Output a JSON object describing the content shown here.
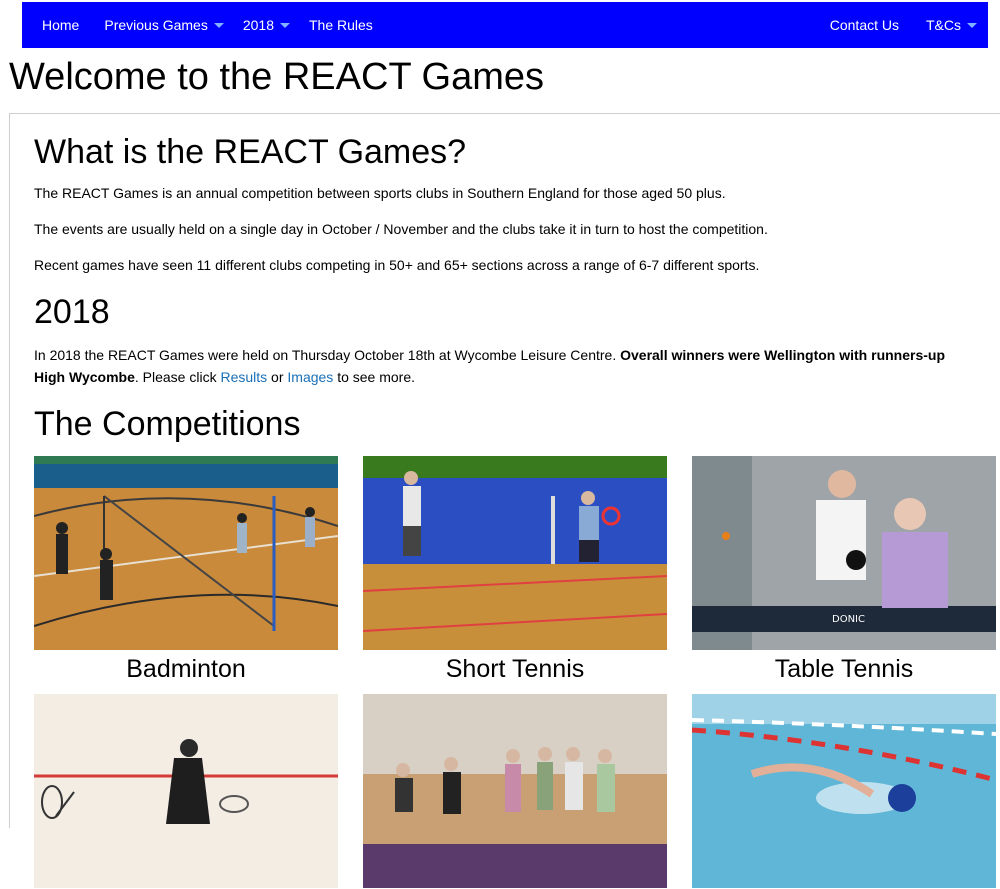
{
  "nav": {
    "left": [
      {
        "label": "Home",
        "dropdown": false
      },
      {
        "label": "Previous Games",
        "dropdown": true
      },
      {
        "label": "2018",
        "dropdown": true
      },
      {
        "label": "The Rules",
        "dropdown": false
      }
    ],
    "right": [
      {
        "label": "Contact Us",
        "dropdown": false
      },
      {
        "label": "T&Cs",
        "dropdown": true
      }
    ],
    "bg_color": "#0000ff"
  },
  "page_title": "Welcome to the REACT Games",
  "about": {
    "heading": "What is the REACT Games?",
    "p1": "The REACT Games is an annual competition between sports clubs in Southern England for those aged 50 plus.",
    "p2": "The events are usually held on a single day in October / November and the clubs take it in turn to host the competition.",
    "p3": "Recent games have seen 11 different clubs competing in 50+ and 65+ sections across a range of 6-7 different sports."
  },
  "year2018": {
    "heading": "2018",
    "text_start": "In 2018 the REACT Games were held on Thursday October 18th at Wycombe Leisure Centre. ",
    "bold": "Overall winners were Wellington with runners-up High Wycombe",
    "text_mid": ". Please click ",
    "link_results": "Results",
    "text_or": " or ",
    "link_images": "Images",
    "text_end": " to see more."
  },
  "competitions": {
    "heading": "The Competitions",
    "items": [
      {
        "caption": "Badminton",
        "icon": "badminton-photo"
      },
      {
        "caption": "Short Tennis",
        "icon": "short-tennis-photo"
      },
      {
        "caption": "Table Tennis",
        "icon": "table-tennis-photo"
      },
      {
        "caption": "",
        "icon": "squash-photo"
      },
      {
        "caption": "",
        "icon": "bowls-photo"
      },
      {
        "caption": "",
        "icon": "swimming-photo"
      }
    ]
  }
}
